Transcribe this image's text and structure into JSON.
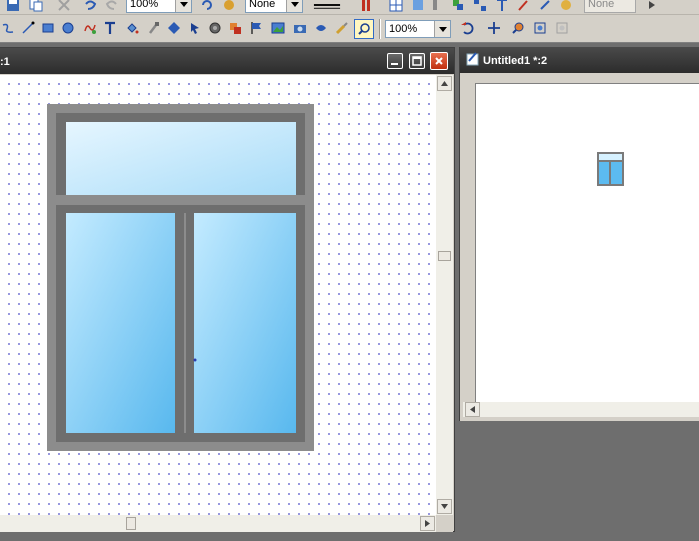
{
  "toolbar_top": {
    "zoom_value": "100%",
    "line_value": "None",
    "none_value_disabled": "None"
  },
  "toolbar_main": {
    "zoom_value": "100%",
    "tools": [
      "connector-tool",
      "line-tool",
      "rectangle-tool",
      "ellipse-tool",
      "freehand-tool",
      "text-tool",
      "bucket-tool",
      "eyedropper-tool",
      "shape-tool",
      "circle-tool",
      "transform-tool",
      "flag-tool",
      "image-tool",
      "camera-tool",
      "link-tool",
      "brush-tool",
      "zoom-tool"
    ]
  },
  "window_main": {
    "title": ":1"
  },
  "window_preview": {
    "title": "Untitled1 *:2"
  },
  "colors": {
    "frame": "#7a7a7a",
    "glass_light": "#d6f1ff",
    "glass_dark": "#5cbbf0",
    "titlebar": "#3a3a3a",
    "close_button": "#d9502b"
  }
}
